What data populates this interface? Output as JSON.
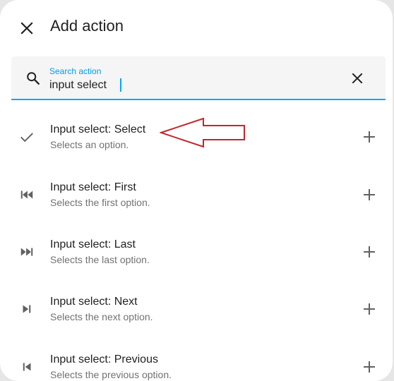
{
  "dialog": {
    "title": "Add action",
    "close_icon": "close-icon"
  },
  "search": {
    "label": "Search action",
    "value": "input select",
    "icon": "search-icon",
    "clear_icon": "clear-icon"
  },
  "actions": [
    {
      "title": "Input select: Select",
      "description": "Selects an option.",
      "icon": "check-icon"
    },
    {
      "title": "Input select: First",
      "description": "Selects the first option.",
      "icon": "skip-first-icon"
    },
    {
      "title": "Input select: Last",
      "description": "Selects the last option.",
      "icon": "skip-last-icon"
    },
    {
      "title": "Input select: Next",
      "description": "Selects the next option.",
      "icon": "skip-next-icon"
    },
    {
      "title": "Input select: Previous",
      "description": "Selects the previous option.",
      "icon": "skip-previous-icon"
    }
  ],
  "colors": {
    "accent": "#03a9f4",
    "annotation_arrow": "#c1272d"
  }
}
